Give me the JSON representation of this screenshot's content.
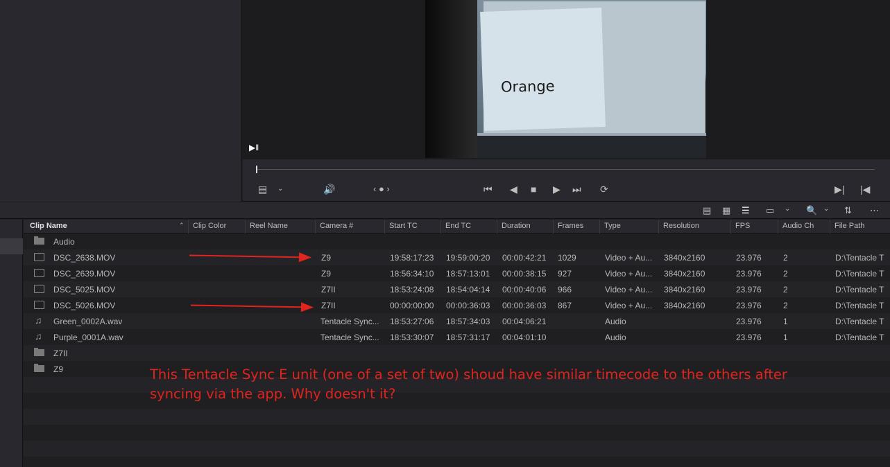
{
  "viewer": {
    "video_text": "Orange"
  },
  "columns": [
    "Clip Name",
    "Clip Color",
    "Reel Name",
    "Camera #",
    "Start TC",
    "End TC",
    "Duration",
    "Frames",
    "Type",
    "Resolution",
    "FPS",
    "Audio Ch",
    "File Path"
  ],
  "rows": [
    {
      "icon": "folder-icon",
      "name": "Audio",
      "camera": "",
      "start": "",
      "end": "",
      "duration": "",
      "frames": "",
      "type": "",
      "resolution": "",
      "fps": "",
      "audio_ch": "",
      "path": ""
    },
    {
      "icon": "clip-icon",
      "name": "DSC_2638.MOV",
      "camera": "Z9",
      "start": "19:58:17:23",
      "end": "19:59:00:20",
      "duration": "00:00:42:21",
      "frames": "1029",
      "type": "Video + Au...",
      "resolution": "3840x2160",
      "fps": "23.976",
      "audio_ch": "2",
      "path": "D:\\Tentacle T"
    },
    {
      "icon": "clip-icon",
      "name": "DSC_2639.MOV",
      "camera": "Z9",
      "start": "18:56:34:10",
      "end": "18:57:13:01",
      "duration": "00:00:38:15",
      "frames": "927",
      "type": "Video + Au...",
      "resolution": "3840x2160",
      "fps": "23.976",
      "audio_ch": "2",
      "path": "D:\\Tentacle T"
    },
    {
      "icon": "clip-icon",
      "name": "DSC_5025.MOV",
      "camera": "Z7II",
      "start": "18:53:24:08",
      "end": "18:54:04:14",
      "duration": "00:00:40:06",
      "frames": "966",
      "type": "Video + Au...",
      "resolution": "3840x2160",
      "fps": "23.976",
      "audio_ch": "2",
      "path": "D:\\Tentacle T"
    },
    {
      "icon": "clip-icon",
      "name": "DSC_5026.MOV",
      "camera": "Z7II",
      "start": "00:00:00:00",
      "end": "00:00:36:03",
      "duration": "00:00:36:03",
      "frames": "867",
      "type": "Video + Au...",
      "resolution": "3840x2160",
      "fps": "23.976",
      "audio_ch": "2",
      "path": "D:\\Tentacle T"
    },
    {
      "icon": "audio-icon",
      "name": "Green_0002A.wav",
      "camera": "Tentacle Sync...",
      "start": "18:53:27:06",
      "end": "18:57:34:03",
      "duration": "00:04:06:21",
      "frames": "",
      "type": "Audio",
      "resolution": "",
      "fps": "23.976",
      "audio_ch": "1",
      "path": "D:\\Tentacle T"
    },
    {
      "icon": "audio-icon",
      "name": "Purple_0001A.wav",
      "camera": "Tentacle Sync...",
      "start": "18:53:30:07",
      "end": "18:57:31:17",
      "duration": "00:04:01:10",
      "frames": "",
      "type": "Audio",
      "resolution": "",
      "fps": "23.976",
      "audio_ch": "1",
      "path": "D:\\Tentacle T"
    },
    {
      "icon": "folder-icon",
      "name": "Z7II",
      "camera": "",
      "start": "",
      "end": "",
      "duration": "",
      "frames": "",
      "type": "",
      "resolution": "",
      "fps": "",
      "audio_ch": "",
      "path": ""
    },
    {
      "icon": "folder-icon",
      "name": "Z9",
      "camera": "",
      "start": "",
      "end": "",
      "duration": "",
      "frames": "",
      "type": "",
      "resolution": "",
      "fps": "",
      "audio_ch": "",
      "path": ""
    }
  ],
  "annotation": {
    "text": "This Tentacle Sync E unit (one of a set of two) shoud have similar timecode to the others after syncing via the app. Why doesn't it?",
    "color": "#e1241e"
  }
}
